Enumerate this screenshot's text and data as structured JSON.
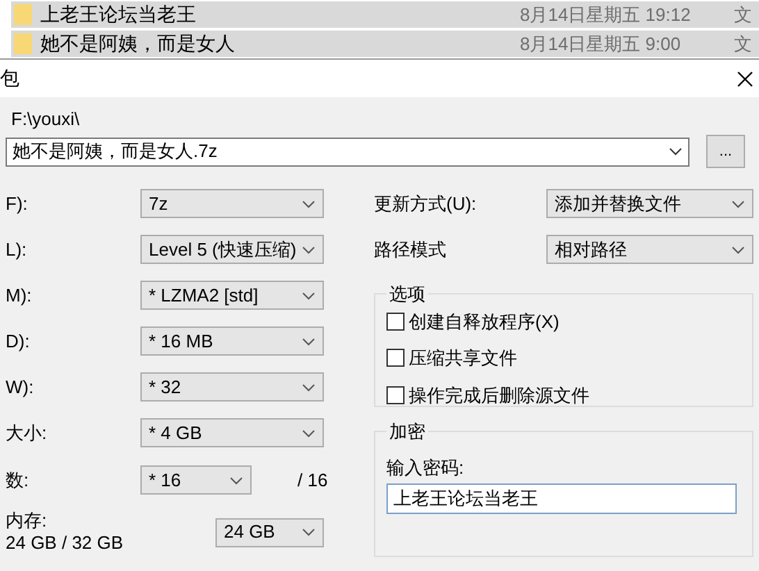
{
  "file_list": [
    {
      "name": "上老王论坛当老王",
      "date": "8月14日星期五 19:12",
      "column_3": "文"
    },
    {
      "name": "她不是阿姨，而是女人",
      "date": "8月14日星期五 9:00",
      "column_3": "文"
    }
  ],
  "dialog": {
    "title": "包",
    "folder": "F:\\youxi\\",
    "archive_name": "她不是阿姨，而是女人.7z",
    "browse_label": "...",
    "settings": [
      {
        "label": "F):",
        "value": "7z",
        "kind": "wide"
      },
      {
        "label": "L):",
        "value": "Level 5 (快速压缩)",
        "kind": "wide"
      },
      {
        "label": "M):",
        "value": "* LZMA2 [std]",
        "kind": "wide"
      },
      {
        "label": "D):",
        "value": "* 16 MB",
        "kind": "wide"
      },
      {
        "label": "W):",
        "value": "* 32",
        "kind": "wide"
      },
      {
        "label": "大小:",
        "value": "* 4 GB",
        "kind": "wide"
      },
      {
        "label": "数:",
        "value": "* 16",
        "kind": "narrow",
        "suffix": "/ 16"
      },
      {
        "label": "内存:",
        "sublabel": "24 GB / 32 GB",
        "value": "24 GB",
        "kind": "memory"
      }
    ],
    "update_mode": {
      "label": "更新方式(U):",
      "value": "添加并替换文件"
    },
    "path_mode": {
      "label": "路径模式",
      "value": "相对路径"
    },
    "options": {
      "title": "选项",
      "items": [
        {
          "label": "创建自释放程序(X)",
          "checked": false
        },
        {
          "label": "压缩共享文件",
          "checked": false
        },
        {
          "label": "操作完成后删除源文件",
          "checked": false
        }
      ]
    },
    "encryption": {
      "title": "加密",
      "password_label": "输入密码:",
      "password": "上老王论坛当老王"
    }
  }
}
